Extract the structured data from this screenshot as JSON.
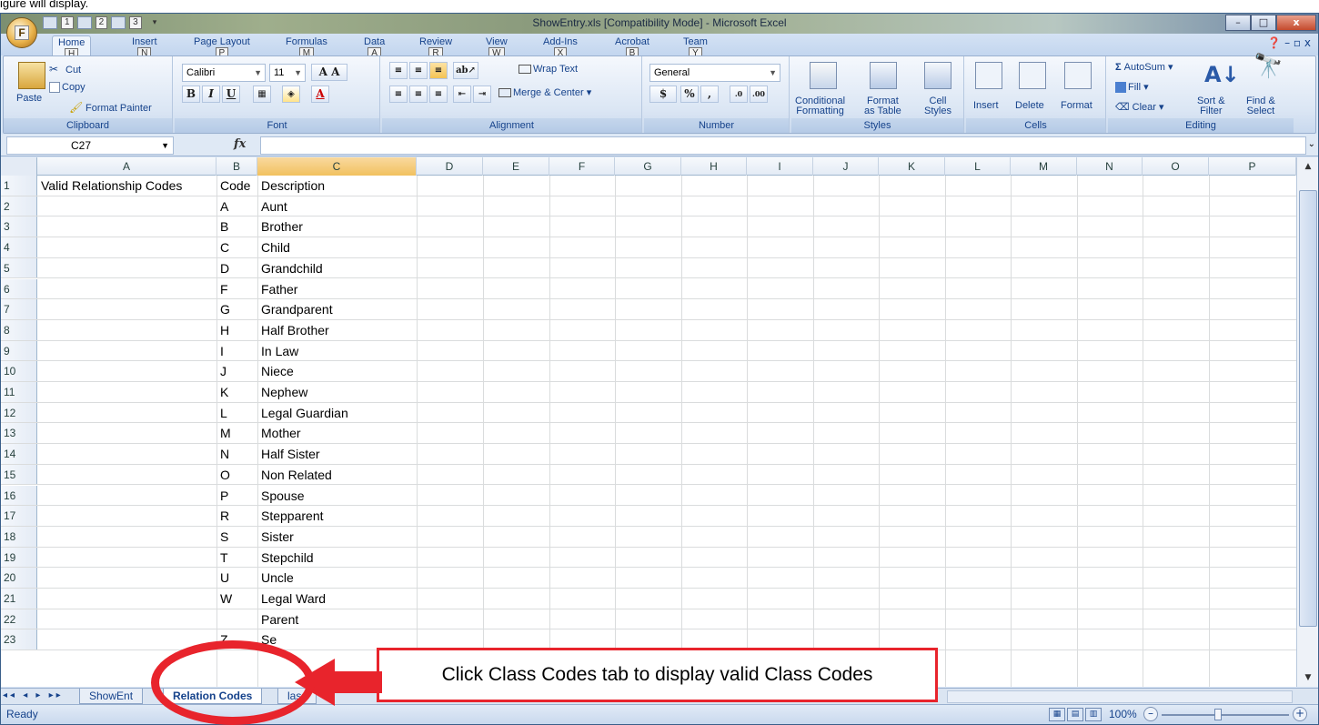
{
  "page_caption": "igure will display.",
  "window": {
    "title": "ShowEntry.xls  [Compatibility Mode] - Microsoft Excel"
  },
  "office_button": {
    "keytip": "F"
  },
  "qat": {
    "keytips": [
      "1",
      "2",
      "3"
    ]
  },
  "ribbon_tabs": [
    {
      "label": "Home",
      "key": "H"
    },
    {
      "label": "Insert",
      "key": "N"
    },
    {
      "label": "Page Layout",
      "key": "P"
    },
    {
      "label": "Formulas",
      "key": "M"
    },
    {
      "label": "Data",
      "key": "A"
    },
    {
      "label": "Review",
      "key": "R"
    },
    {
      "label": "View",
      "key": "W"
    },
    {
      "label": "Add-Ins",
      "key": "X"
    },
    {
      "label": "Acrobat",
      "key": "B"
    },
    {
      "label": "Team",
      "key": "Y"
    }
  ],
  "ribbon": {
    "clipboard": {
      "group": "Clipboard",
      "paste": "Paste",
      "cut": "Cut",
      "copy": "Copy",
      "format_painter": "Format Painter"
    },
    "font": {
      "group": "Font",
      "name": "Calibri",
      "size": "11",
      "bold": "B",
      "italic": "I",
      "underline": "U"
    },
    "alignment": {
      "group": "Alignment",
      "wrap": "Wrap Text",
      "merge": "Merge & Center"
    },
    "number": {
      "group": "Number",
      "format": "General",
      "currency": "$",
      "percent": "%",
      "comma": ","
    },
    "styles": {
      "group": "Styles",
      "conditional": "Conditional",
      "conditional2": "Formatting",
      "format_table": "Format",
      "format_table2": "as Table",
      "cell_styles": "Cell",
      "cell_styles2": "Styles"
    },
    "cells": {
      "group": "Cells",
      "insert": "Insert",
      "delete": "Delete",
      "format": "Format"
    },
    "editing": {
      "group": "Editing",
      "autosum": "AutoSum",
      "fill": "Fill",
      "clear": "Clear",
      "sort": "Sort &",
      "sort2": "Filter",
      "find": "Find &",
      "find2": "Select"
    }
  },
  "formula_bar": {
    "name_box": "C27",
    "fx": "fx",
    "value": ""
  },
  "columns": [
    "A",
    "B",
    "C",
    "D",
    "E",
    "F",
    "G",
    "H",
    "I",
    "J",
    "K",
    "L",
    "M",
    "N",
    "O",
    "P"
  ],
  "selected_column": "C",
  "rows": [
    {
      "n": "1",
      "a": "Valid Relationship Codes",
      "b": "Code",
      "c": "Description"
    },
    {
      "n": "2",
      "a": "",
      "b": "A",
      "c": "Aunt"
    },
    {
      "n": "3",
      "a": "",
      "b": "B",
      "c": "Brother"
    },
    {
      "n": "4",
      "a": "",
      "b": "C",
      "c": "Child"
    },
    {
      "n": "5",
      "a": "",
      "b": "D",
      "c": "Grandchild"
    },
    {
      "n": "6",
      "a": "",
      "b": "F",
      "c": "Father"
    },
    {
      "n": "7",
      "a": "",
      "b": "G",
      "c": "Grandparent"
    },
    {
      "n": "8",
      "a": "",
      "b": "H",
      "c": "Half Brother"
    },
    {
      "n": "9",
      "a": "",
      "b": "I",
      "c": "In Law"
    },
    {
      "n": "10",
      "a": "",
      "b": "J",
      "c": "Niece"
    },
    {
      "n": "11",
      "a": "",
      "b": "K",
      "c": "Nephew"
    },
    {
      "n": "12",
      "a": "",
      "b": "L",
      "c": "Legal Guardian"
    },
    {
      "n": "13",
      "a": "",
      "b": "M",
      "c": "Mother"
    },
    {
      "n": "14",
      "a": "",
      "b": "N",
      "c": "Half Sister"
    },
    {
      "n": "15",
      "a": "",
      "b": "O",
      "c": "Non Related"
    },
    {
      "n": "16",
      "a": "",
      "b": "P",
      "c": "Spouse"
    },
    {
      "n": "17",
      "a": "",
      "b": "R",
      "c": "Stepparent"
    },
    {
      "n": "18",
      "a": "",
      "b": "S",
      "c": "Sister"
    },
    {
      "n": "19",
      "a": "",
      "b": "T",
      "c": "Stepchild"
    },
    {
      "n": "20",
      "a": "",
      "b": "U",
      "c": "Uncle"
    },
    {
      "n": "21",
      "a": "",
      "b": "W",
      "c": "Legal Ward"
    },
    {
      "n": "22",
      "a": "",
      "b": "",
      "c": "Parent"
    },
    {
      "n": "23",
      "a": "",
      "b": "Z",
      "c": "Se"
    }
  ],
  "sheet_tabs": [
    "ShowEnt",
    "Relation Codes",
    "lass"
  ],
  "active_sheet": "Relation Codes",
  "status": {
    "ready": "Ready",
    "zoom": "100%"
  },
  "annotation": {
    "callout": "Click Class Codes tab to display valid Class Codes",
    "highlight_color": "#e8242c"
  }
}
